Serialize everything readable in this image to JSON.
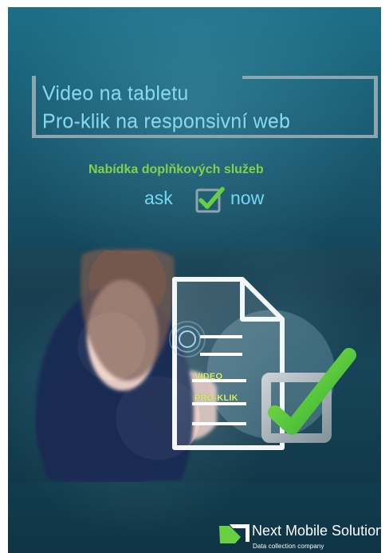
{
  "poster": {
    "title_line_1": "Video na tabletu",
    "title_line_2": "Pro-klik na responsivní web",
    "subtitle": "Nabídka doplňkových služeb",
    "ask_prefix": "ask",
    "ask_suffix": "now",
    "document": {
      "label_1": "VIDEO",
      "label_2": "PRO-KLIK"
    },
    "brand": {
      "name": "Next Mobile Solutions",
      "tagline": "Data collection company"
    },
    "icons": {
      "ask_check": "check-icon",
      "document": "document-icon",
      "large_check": "check-icon",
      "logo": "logo-icon"
    },
    "colors": {
      "background": "#174e63",
      "title": "#7fd9f4",
      "subtitle": "#82d14a",
      "accent_check": "#6fd03e",
      "document_label": "#d8f06c"
    }
  }
}
